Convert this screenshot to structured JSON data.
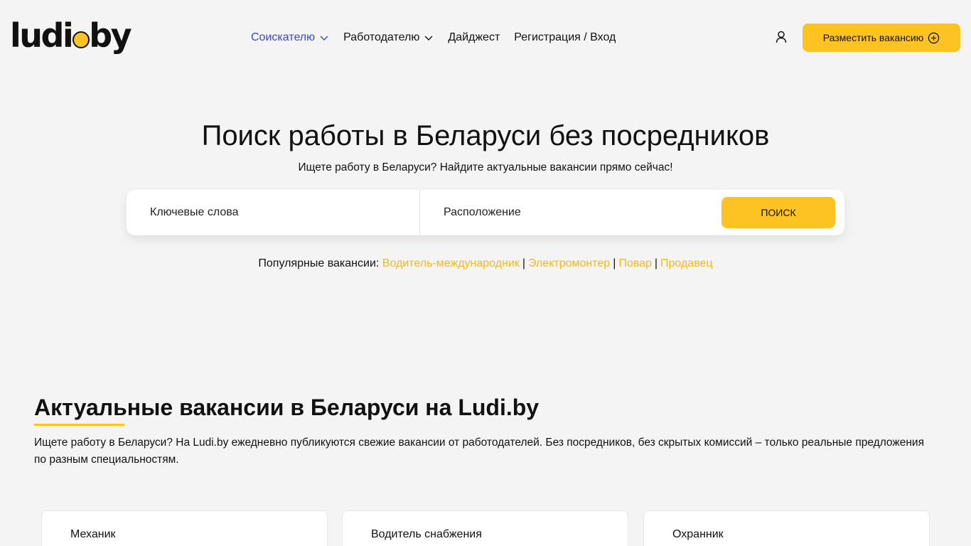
{
  "header": {
    "logo_text_left": "ludi",
    "logo_text_right": "by",
    "nav": [
      {
        "label": "Соискателю"
      },
      {
        "label": "Работодателю"
      },
      {
        "label": "Дайджест"
      },
      {
        "label": "Регистрация / Вход"
      }
    ],
    "post_button_label": "Разместить вакансию"
  },
  "hero": {
    "title": "Поиск работы в Беларуси без посредников",
    "subtitle": "Ищете работу в Беларуси? Найдите актуальные вакансии прямо сейчас!",
    "keywords_placeholder": "Ключевые слова",
    "location_placeholder": "Расположение",
    "search_button_label": "ПОИСК",
    "popular_label": "Популярные вакансии:",
    "popular_links": [
      {
        "label": "Водитель-международник"
      },
      {
        "label": "Электромонтер"
      },
      {
        "label": "Повар"
      },
      {
        "label": "Продавец"
      }
    ]
  },
  "section": {
    "title": "Актуальные вакансии в Беларуси на Ludi.by",
    "description": "Ищете работу в Беларуси? На Ludi.by ежедневно публикуются свежие вакансии от работодателей. Без посредников, без скрытых комиссий – только реальные предложения по разным специальностям.",
    "cards": [
      {
        "title": "Механик"
      },
      {
        "title": "Водитель снабжения"
      },
      {
        "title": "Охранник"
      }
    ]
  },
  "colors": {
    "accent": "#fcc322",
    "link": "#f5b824",
    "nav_active": "#3f45c8",
    "background": "#f3f4f3"
  }
}
